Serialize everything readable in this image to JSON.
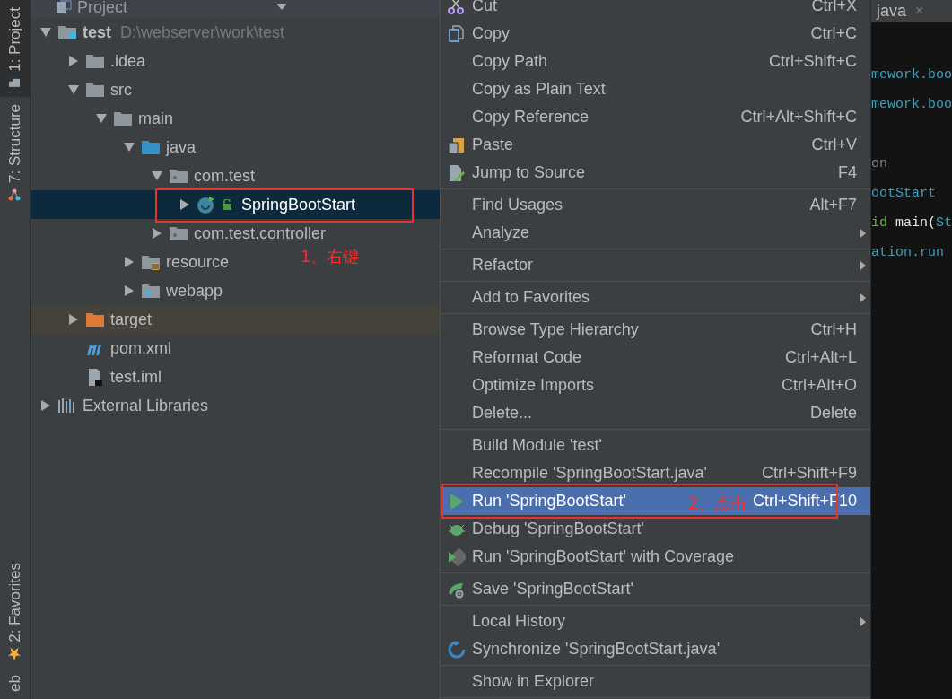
{
  "tool_strip": [
    {
      "label": "1: Project",
      "kind": "project",
      "selected": true
    },
    {
      "label": "7: Structure",
      "kind": "structure",
      "selected": false
    },
    {
      "label": "2: Favorites",
      "kind": "favorites",
      "selected": false
    },
    {
      "label": "eb",
      "kind": "web",
      "selected": false
    }
  ],
  "project_panel": {
    "title": "Project",
    "tree": [
      {
        "label": "test",
        "hint": "D:\\webserver\\work\\test",
        "kind": "module",
        "expanded": true,
        "selected": false,
        "children": [
          {
            "label": ".idea",
            "kind": "folder",
            "expanded": false,
            "selected": false
          },
          {
            "label": "src",
            "kind": "folder",
            "expanded": true,
            "selected": false,
            "children": [
              {
                "label": "main",
                "kind": "folder",
                "expanded": true,
                "selected": false,
                "children": [
                  {
                    "label": "java",
                    "kind": "source-folder",
                    "expanded": true,
                    "selected": false,
                    "children": [
                      {
                        "label": "com.test",
                        "kind": "package",
                        "expanded": true,
                        "selected": false,
                        "children": [
                          {
                            "label": "SpringBootStart",
                            "kind": "class",
                            "expanded": false,
                            "selected": true
                          }
                        ]
                      },
                      {
                        "label": "com.test.controller",
                        "kind": "package",
                        "expanded": false,
                        "selected": false
                      }
                    ]
                  },
                  {
                    "label": "resource",
                    "kind": "resource-folder",
                    "expanded": false,
                    "selected": false
                  },
                  {
                    "label": "webapp",
                    "kind": "web-folder",
                    "expanded": false,
                    "selected": false
                  }
                ]
              }
            ]
          },
          {
            "label": "target",
            "kind": "excluded-folder",
            "expanded": false,
            "selected": false
          },
          {
            "label": "pom.xml",
            "kind": "maven",
            "selected": false
          },
          {
            "label": "test.iml",
            "kind": "iml",
            "selected": false
          }
        ]
      },
      {
        "label": "External Libraries",
        "kind": "libraries",
        "expanded": false,
        "selected": false
      }
    ]
  },
  "context_menu": {
    "groups": [
      [
        {
          "label": "Cut",
          "shortcut": "Ctrl+X",
          "kind": "cut",
          "submenu": false,
          "selected": false
        },
        {
          "label": "Copy",
          "shortcut": "Ctrl+C",
          "kind": "copy",
          "submenu": false,
          "selected": false
        },
        {
          "label": "Copy Path",
          "shortcut": "Ctrl+Shift+C",
          "submenu": false,
          "selected": false
        },
        {
          "label": "Copy as Plain Text",
          "submenu": false,
          "selected": false
        },
        {
          "label": "Copy Reference",
          "shortcut": "Ctrl+Alt+Shift+C",
          "submenu": false,
          "selected": false
        },
        {
          "label": "Paste",
          "shortcut": "Ctrl+V",
          "kind": "paste",
          "submenu": false,
          "selected": false
        },
        {
          "label": "Jump to Source",
          "shortcut": "F4",
          "kind": "edit",
          "submenu": false,
          "selected": false
        }
      ],
      [
        {
          "label": "Find Usages",
          "shortcut": "Alt+F7",
          "submenu": false,
          "selected": false
        },
        {
          "label": "Analyze",
          "submenu": true,
          "selected": false
        }
      ],
      [
        {
          "label": "Refactor",
          "submenu": true,
          "selected": false
        }
      ],
      [
        {
          "label": "Add to Favorites",
          "submenu": true,
          "selected": false
        }
      ],
      [
        {
          "label": "Browse Type Hierarchy",
          "shortcut": "Ctrl+H",
          "submenu": false,
          "selected": false
        },
        {
          "label": "Reformat Code",
          "shortcut": "Ctrl+Alt+L",
          "submenu": false,
          "selected": false
        },
        {
          "label": "Optimize Imports",
          "shortcut": "Ctrl+Alt+O",
          "submenu": false,
          "selected": false
        },
        {
          "label": "Delete...",
          "shortcut": "Delete",
          "submenu": false,
          "selected": false
        }
      ],
      [
        {
          "label": "Build Module 'test'",
          "submenu": false,
          "selected": false
        },
        {
          "label": "Recompile 'SpringBootStart.java'",
          "shortcut": "Ctrl+Shift+F9",
          "submenu": false,
          "selected": false
        },
        {
          "label": "Run 'SpringBootStart'",
          "shortcut": "Ctrl+Shift+F10",
          "kind": "run",
          "submenu": false,
          "selected": true
        },
        {
          "label": "Debug 'SpringBootStart'",
          "kind": "debug",
          "submenu": false,
          "selected": false
        },
        {
          "label": "Run 'SpringBootStart' with Coverage",
          "kind": "coverage",
          "submenu": false,
          "selected": false
        }
      ],
      [
        {
          "label": "Save 'SpringBootStart'",
          "kind": "save",
          "submenu": false,
          "selected": false
        }
      ],
      [
        {
          "label": "Local History",
          "submenu": true,
          "selected": false
        },
        {
          "label": "Synchronize 'SpringBootStart.java'",
          "kind": "sync",
          "submenu": false,
          "selected": false
        }
      ],
      [
        {
          "label": "Show in Explorer",
          "submenu": false,
          "selected": false
        }
      ]
    ]
  },
  "editor": {
    "tab": {
      "label": "java",
      "close": "×"
    },
    "lines": [
      [
        {
          "text": "mework.boo",
          "kind": "type"
        }
      ],
      [
        {
          "text": "mework.boo",
          "kind": "type"
        }
      ],
      [
        {
          "text": "on",
          "kind": "comment"
        }
      ],
      [
        {
          "text": "ootStart",
          "kind": "type"
        }
      ],
      [
        {
          "text": "id",
          "kind": "keyword"
        },
        {
          "text": " main(",
          "kind": "plain"
        },
        {
          "text": "St",
          "kind": "type"
        }
      ],
      [
        {
          "text": "ation.run",
          "kind": "type"
        }
      ]
    ]
  },
  "annotations": [
    {
      "text": "1、右键"
    },
    {
      "text": "2、点击"
    }
  ]
}
